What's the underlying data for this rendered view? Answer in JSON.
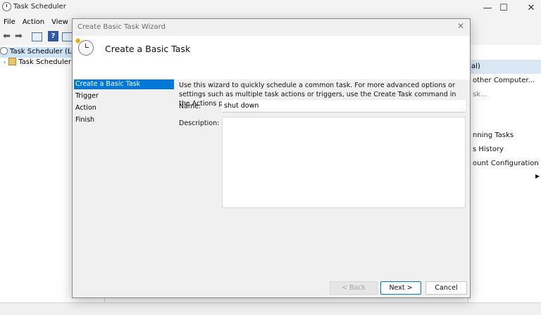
{
  "window": {
    "title": "Task Scheduler",
    "minimize_glyph": "—",
    "maximize_glyph": "☐",
    "close_glyph": "✕"
  },
  "menu": [
    "File",
    "Action",
    "View"
  ],
  "tree": {
    "root_label": "Task Scheduler (Loca",
    "child_label": "Task Scheduler L"
  },
  "actions_pane": {
    "header": "al)",
    "items": [
      "other Computer...",
      "sk...",
      "nning Tasks",
      "s History",
      "ount Configuration"
    ]
  },
  "dialog": {
    "title": "Create Basic Task Wizard",
    "heading": "Create a Basic Task",
    "steps": [
      "Create a Basic Task",
      "Trigger",
      "Action",
      "Finish"
    ],
    "active_step": "Create a Basic Task",
    "description": "Use this wizard to quickly schedule a common task.  For more advanced options or settings such as multiple task actions or triggers, use the Create Task command in the Actions pane.",
    "name_label": "Name:",
    "name_value": "shut down",
    "description_label": "Description:",
    "description_value": "",
    "buttons": {
      "back": "< Back",
      "next": "Next >",
      "cancel": "Cancel"
    }
  },
  "colors": {
    "accent": "#0078d7",
    "selection_header": "#dce7f5"
  }
}
